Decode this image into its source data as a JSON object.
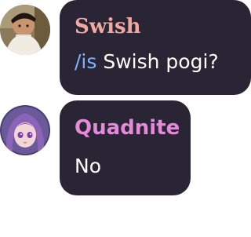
{
  "messages": [
    {
      "author": "Swish",
      "author_color": "#f2a7a1",
      "command": "/is",
      "body": " Swish pogi?",
      "avatar_icon": "user-photo-avatar"
    },
    {
      "author": "Quadnite",
      "author_color": "#e58ad8",
      "body": "No",
      "avatar_icon": "anime-character-avatar"
    }
  ],
  "colors": {
    "bubble": "#2a2535",
    "command": "#7fb3ff",
    "text": "#ffffff"
  }
}
